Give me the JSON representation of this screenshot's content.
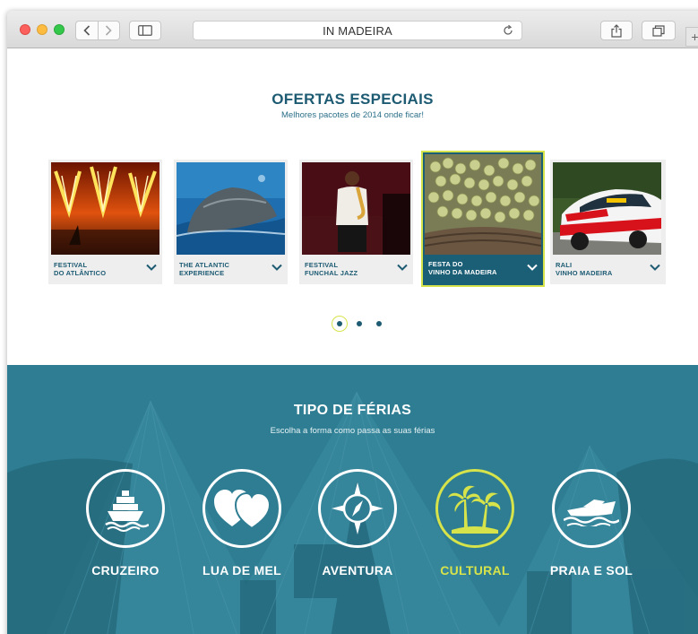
{
  "browser": {
    "url_text": "IN MADEIRA",
    "new_tab": "+"
  },
  "offers": {
    "title": "OFERTAS ESPECIAIS",
    "subtitle": "Melhores pacotes de 2014 onde ficar!",
    "cards": [
      {
        "line1": "FESTIVAL",
        "line2": "DO ATLÂNTICO"
      },
      {
        "line1": "THE ATLANTIC",
        "line2": "EXPERIENCE"
      },
      {
        "line1": "FESTIVAL",
        "line2": "FUNCHAL JAZZ"
      },
      {
        "line1": "FESTA DO",
        "line2": "VINHO DA MADEIRA"
      },
      {
        "line1": "RALI",
        "line2": "VINHO MADEIRA"
      }
    ],
    "active_card_index": 3,
    "page_count": 3,
    "active_page": 1
  },
  "holiday_types": {
    "title": "TIPO DE FÉRIAS",
    "subtitle": "Escolha a forma como passa as suas férias",
    "items": [
      {
        "label": "CRUZEIRO",
        "icon": "ship-icon"
      },
      {
        "label": "LUA DE MEL",
        "icon": "hearts-icon"
      },
      {
        "label": "AVENTURA",
        "icon": "compass-icon"
      },
      {
        "label": "CULTURAL",
        "icon": "palm-trees-icon"
      },
      {
        "label": "PRAIA E SOL",
        "icon": "speedboat-icon"
      }
    ],
    "selected_index": 3
  },
  "colors": {
    "brand_dark": "#1d5b73",
    "accent_lime": "#d6e34a",
    "section_teal": "#2e7d92"
  }
}
